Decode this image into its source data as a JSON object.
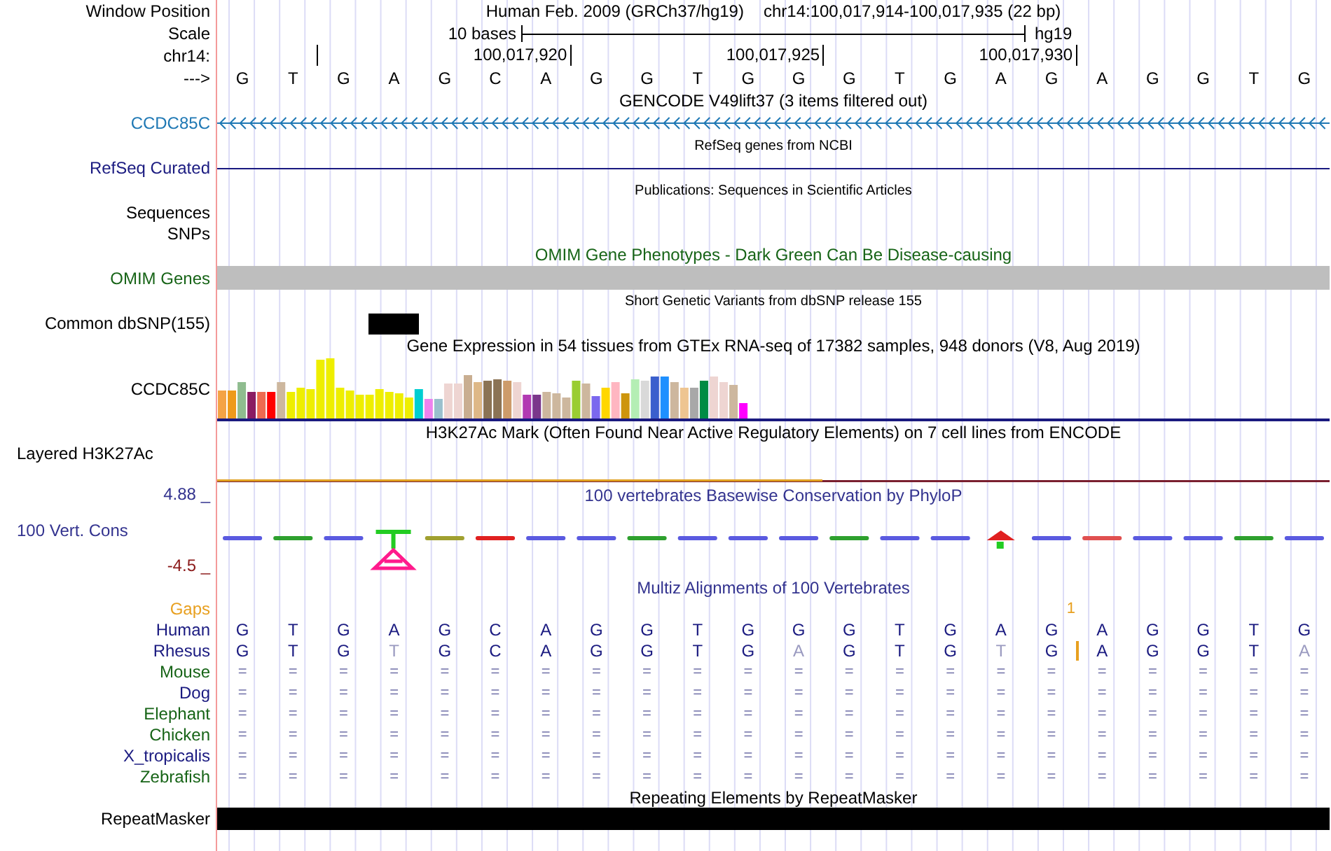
{
  "position": {
    "label": "Window Position",
    "assembly": "Human Feb. 2009 (GRCh37/hg19)",
    "range": "chr14:100,017,914-100,017,935 (22 bp)"
  },
  "scale": {
    "label": "Scale",
    "bar_label": "10 bases",
    "assembly": "hg19"
  },
  "ruler": {
    "label": "chr14:",
    "ticks": [
      "100,017,920",
      "100,017,925",
      "100,017,930"
    ]
  },
  "sequence": {
    "label": "--->",
    "bases": [
      "G",
      "T",
      "G",
      "A",
      "G",
      "C",
      "A",
      "G",
      "G",
      "T",
      "G",
      "G",
      "G",
      "T",
      "G",
      "A",
      "G",
      "A",
      "G",
      "G",
      "T",
      "G"
    ]
  },
  "tracks": [
    {
      "kind": "gene",
      "title": "GENCODE V49lift37 (3 items filtered out)",
      "labels": [
        "CCDC85C"
      ],
      "color": "#1f78b4"
    },
    {
      "kind": "line",
      "title": "RefSeq genes from NCBI",
      "labels": [
        "RefSeq Curated"
      ],
      "color": "#1a1a80"
    },
    {
      "kind": "empty",
      "title": "Publications: Sequences in Scientific Articles",
      "labels": [
        "Sequences",
        "SNPs"
      ],
      "color": "#000000"
    },
    {
      "kind": "bar",
      "title": "OMIM Gene Phenotypes - Dark Green Can Be Disease-causing",
      "labels": [
        "OMIM Genes"
      ],
      "color": "#176417"
    },
    {
      "kind": "variant",
      "title": "Short Genetic Variants from dbSNP release 155",
      "labels": [
        "Common dbSNP(155)"
      ],
      "color": "#000000"
    },
    {
      "kind": "expression",
      "title": "Gene Expression in 54 tissues from GTEx RNA-seq of 17382 samples, 948 donors (V8, Aug 2019)",
      "labels": [
        "CCDC85C"
      ],
      "color": "#000000"
    },
    {
      "kind": "signal",
      "title": "H3K27Ac Mark (Often Found Near Active Regulatory Elements) on 7 cell lines from ENCODE",
      "labels": [
        "Layered H3K27Ac"
      ],
      "color": "#000000"
    },
    {
      "kind": "conservation",
      "title": "100 vertebrates Basewise Conservation by PhyloP",
      "labels": [
        "4.88 _",
        "100 Vert. Cons",
        "-4.5 _"
      ],
      "color": "#33338f"
    },
    {
      "kind": "repeat",
      "title": "Repeating Elements by RepeatMasker",
      "labels": [
        "RepeatMasker"
      ],
      "color": "#000000"
    }
  ],
  "alignment": {
    "title": "Multiz Alignments of 100 Vertebrates",
    "gaps_label": "Gaps",
    "gap_count": "1",
    "human": {
      "name": "Human",
      "bases": [
        "G",
        "T",
        "G",
        "A",
        "G",
        "C",
        "A",
        "G",
        "G",
        "T",
        "G",
        "G",
        "G",
        "T",
        "G",
        "A",
        "G",
        "A",
        "G",
        "G",
        "T",
        "G"
      ]
    },
    "rhesus": {
      "name": "Rhesus",
      "cells": [
        {
          "base": "G",
          "mismatch": false,
          "insertion": false
        },
        {
          "base": "T",
          "mismatch": false,
          "insertion": false
        },
        {
          "base": "G",
          "mismatch": false,
          "insertion": false
        },
        {
          "base": "T",
          "mismatch": true,
          "insertion": false
        },
        {
          "base": "G",
          "mismatch": false,
          "insertion": false
        },
        {
          "base": "C",
          "mismatch": false,
          "insertion": false
        },
        {
          "base": "A",
          "mismatch": false,
          "insertion": false
        },
        {
          "base": "G",
          "mismatch": false,
          "insertion": false
        },
        {
          "base": "G",
          "mismatch": false,
          "insertion": false
        },
        {
          "base": "T",
          "mismatch": false,
          "insertion": false
        },
        {
          "base": "G",
          "mismatch": false,
          "insertion": false
        },
        {
          "base": "A",
          "mismatch": true,
          "insertion": false
        },
        {
          "base": "G",
          "mismatch": false,
          "insertion": false
        },
        {
          "base": "T",
          "mismatch": false,
          "insertion": false
        },
        {
          "base": "G",
          "mismatch": false,
          "insertion": false
        },
        {
          "base": "T",
          "mismatch": true,
          "insertion": false
        },
        {
          "base": "G",
          "mismatch": false,
          "insertion": true
        },
        {
          "base": "A",
          "mismatch": false,
          "insertion": false
        },
        {
          "base": "G",
          "mismatch": false,
          "insertion": false
        },
        {
          "base": "G",
          "mismatch": false,
          "insertion": false
        },
        {
          "base": "T",
          "mismatch": false,
          "insertion": false
        },
        {
          "base": "A",
          "mismatch": true,
          "insertion": false
        }
      ]
    },
    "species": [
      {
        "name": "Mouse",
        "color": "#176417",
        "cells": [
          "=",
          "=",
          "=",
          "=",
          "=",
          "=",
          "=",
          "=",
          "=",
          "=",
          "=",
          "=",
          "=",
          "=",
          "=",
          "=",
          "=",
          "=",
          "=",
          "=",
          "=",
          "="
        ]
      },
      {
        "name": "Dog",
        "color": "#1a1a80",
        "cells": [
          "=",
          "=",
          "=",
          "=",
          "=",
          "=",
          "=",
          "=",
          "=",
          "=",
          "=",
          "=",
          "=",
          "=",
          "=",
          "=",
          "=",
          "=",
          "=",
          "=",
          "=",
          "="
        ]
      },
      {
        "name": "Elephant",
        "color": "#176417",
        "cells": [
          "=",
          "=",
          "=",
          "=",
          "=",
          "=",
          "=",
          "=",
          "=",
          "=",
          "=",
          "=",
          "=",
          "=",
          "=",
          "=",
          "=",
          "=",
          "=",
          "=",
          "=",
          "="
        ]
      },
      {
        "name": "Chicken",
        "color": "#176417",
        "cells": [
          "=",
          "=",
          "=",
          "=",
          "=",
          "=",
          "=",
          "=",
          "=",
          "=",
          "=",
          "=",
          "=",
          "=",
          "=",
          "=",
          "=",
          "=",
          "=",
          "=",
          "=",
          "="
        ]
      },
      {
        "name": "X_tropicalis",
        "color": "#1a1a80",
        "cells": [
          "=",
          "=",
          "=",
          "=",
          "=",
          "=",
          "=",
          "=",
          "=",
          "=",
          "=",
          "=",
          "=",
          "=",
          "=",
          "=",
          "=",
          "=",
          "=",
          "=",
          "=",
          "="
        ]
      },
      {
        "name": "Zebrafish",
        "color": "#176417",
        "cells": [
          "=",
          "=",
          "=",
          "=",
          "=",
          "=",
          "=",
          "=",
          "=",
          "=",
          "=",
          "=",
          "=",
          "=",
          "=",
          "=",
          "=",
          "=",
          "=",
          "=",
          "=",
          "="
        ]
      }
    ]
  }
}
